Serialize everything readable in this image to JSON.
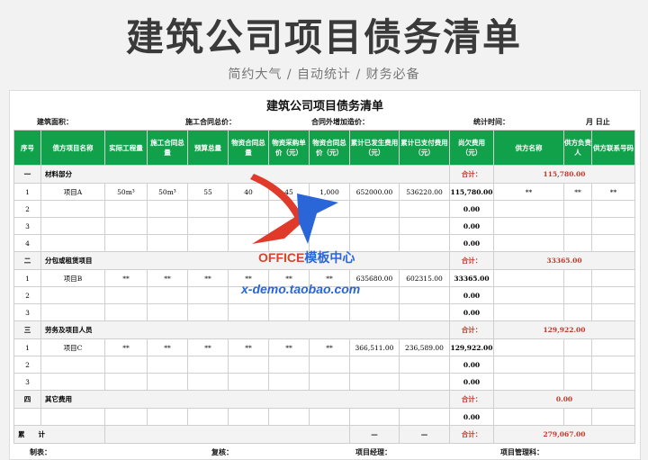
{
  "banner": {
    "title": "建筑公司项目债务清单",
    "subtitle": "简约大气 / 自动统计 / 财务必备"
  },
  "sheet": {
    "title": "建筑公司项目债务清单",
    "meta": [
      "建筑面积：",
      "施工合同总价：",
      "合同外增加造价：",
      "统计时间：",
      "月 日止"
    ]
  },
  "headers": [
    "序号",
    "债方项目名称",
    "实际工程量",
    "施工合同总量",
    "预算总量",
    "物资合同总量",
    "物资采购单价（元）",
    "物资合同总价（元）",
    "累计已发生费用（元）",
    "累计已支付费用（元）",
    "尚欠费用（元）",
    "",
    "供方名称",
    "供方负责人",
    "供方联系号码"
  ],
  "rows": [
    {
      "kind": "grp",
      "seq": "一",
      "name": "材料部分",
      "total_label": "合计：",
      "total": "115,780.00"
    },
    {
      "kind": "row",
      "cells": [
        "1",
        "项目A",
        "50m³",
        "50m³",
        "55",
        "40",
        "45",
        "1,000",
        "652000.00",
        "536220.00",
        "115,780.00",
        "",
        "**",
        "**",
        "**"
      ]
    },
    {
      "kind": "row",
      "cells": [
        "2",
        "",
        "",
        "",
        "",
        "",
        "",
        "",
        "",
        "",
        "0.00",
        "",
        "",
        "",
        ""
      ]
    },
    {
      "kind": "row",
      "cells": [
        "3",
        "",
        "",
        "",
        "",
        "",
        "",
        "",
        "",
        "",
        "0.00",
        "",
        "",
        "",
        ""
      ]
    },
    {
      "kind": "row",
      "cells": [
        "4",
        "",
        "",
        "",
        "",
        "",
        "",
        "",
        "",
        "",
        "0.00",
        "",
        "",
        "",
        ""
      ]
    },
    {
      "kind": "grp",
      "seq": "二",
      "name": "分包或租赁项目",
      "total_label": "合计：",
      "total": "33365.00"
    },
    {
      "kind": "row",
      "cells": [
        "1",
        "项目B",
        "**",
        "**",
        "**",
        "**",
        "**",
        "**",
        "635680.00",
        "602315.00",
        "33365.00",
        "",
        "",
        "",
        ""
      ]
    },
    {
      "kind": "row",
      "cells": [
        "2",
        "",
        "",
        "",
        "",
        "",
        "",
        "",
        "",
        "",
        "0.00",
        "",
        "",
        "",
        ""
      ]
    },
    {
      "kind": "row",
      "cells": [
        "3",
        "",
        "",
        "",
        "",
        "",
        "",
        "",
        "",
        "",
        "0.00",
        "",
        "",
        "",
        ""
      ]
    },
    {
      "kind": "grp",
      "seq": "三",
      "name": "劳务及项目人员",
      "total_label": "合计：",
      "total": "129,922.00"
    },
    {
      "kind": "row",
      "cells": [
        "1",
        "项目C",
        "**",
        "**",
        "**",
        "**",
        "**",
        "**",
        "366,511.00",
        "236,589.00",
        "129,922.00",
        "",
        "",
        "",
        ""
      ]
    },
    {
      "kind": "row",
      "cells": [
        "2",
        "",
        "",
        "",
        "",
        "",
        "",
        "",
        "",
        "",
        "0.00",
        "",
        "",
        "",
        ""
      ]
    },
    {
      "kind": "row",
      "cells": [
        "3",
        "",
        "",
        "",
        "",
        "",
        "",
        "",
        "",
        "",
        "0.00",
        "",
        "",
        "",
        ""
      ]
    },
    {
      "kind": "grp",
      "seq": "四",
      "name": "其它费用",
      "total_label": "合计：",
      "total": "0.00"
    },
    {
      "kind": "row",
      "cells": [
        "",
        "",
        "",
        "",
        "",
        "",
        "",
        "",
        "",
        "",
        "0.00",
        "",
        "",
        "",
        ""
      ]
    },
    {
      "kind": "total",
      "seq": "累　　计",
      "dash1": "—",
      "dash2": "—",
      "total_label": "合计：",
      "total": "279,067.00"
    }
  ],
  "footer": [
    "制表：",
    "复核：",
    "项目经理：",
    "项目管理科："
  ],
  "watermark": {
    "brand_a": "OFFICE",
    "brand_b": "模板中心",
    "url": "x-demo.taobao.com"
  },
  "colors": {
    "header_bg": "#12a14b",
    "total_red": "#c0392b"
  }
}
